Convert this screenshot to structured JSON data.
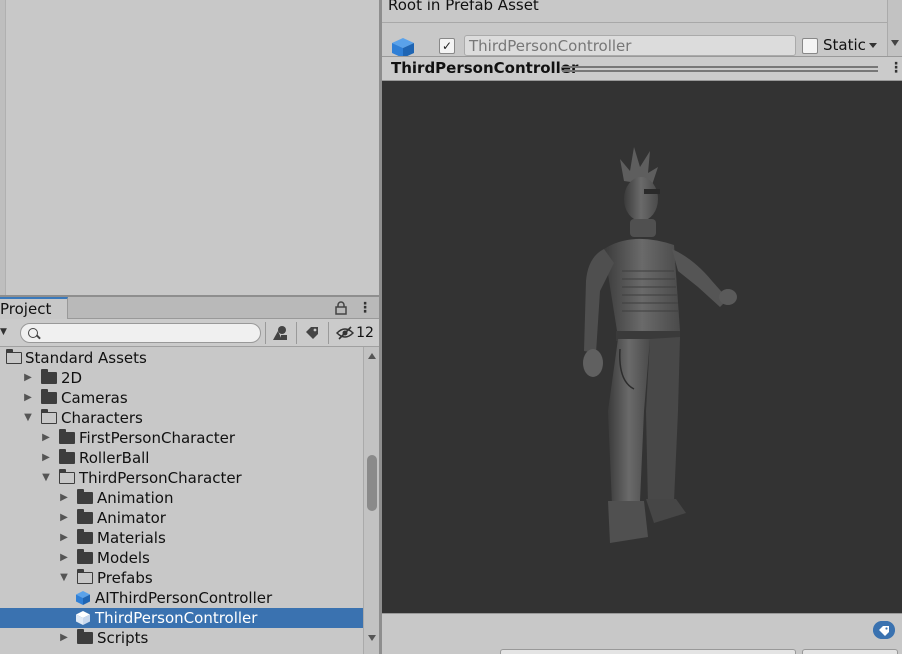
{
  "inspector": {
    "header_text": "Root in Prefab Asset",
    "object_name": "ThirdPersonController",
    "active_checked": true,
    "active_check_glyph": "✓",
    "static_label": "Static",
    "static_checked": false
  },
  "preview": {
    "title": "ThirdPersonController",
    "menu_glyph": "⋮",
    "background_color": "#333333"
  },
  "project": {
    "tab_label": "Project",
    "menu_glyph": "⋮",
    "hidden_count": "12",
    "search_placeholder": "",
    "tree": [
      {
        "label": "Standard Assets",
        "depth": 0,
        "kind": "folder-open",
        "arrow": "none"
      },
      {
        "label": "2D",
        "depth": 1,
        "kind": "folder",
        "arrow": "collapsed"
      },
      {
        "label": "Cameras",
        "depth": 1,
        "kind": "folder",
        "arrow": "collapsed"
      },
      {
        "label": "Characters",
        "depth": 1,
        "kind": "folder-open",
        "arrow": "expanded"
      },
      {
        "label": "FirstPersonCharacter",
        "depth": 2,
        "kind": "folder",
        "arrow": "collapsed"
      },
      {
        "label": "RollerBall",
        "depth": 2,
        "kind": "folder",
        "arrow": "collapsed"
      },
      {
        "label": "ThirdPersonCharacter",
        "depth": 2,
        "kind": "folder-open",
        "arrow": "expanded"
      },
      {
        "label": "Animation",
        "depth": 3,
        "kind": "folder",
        "arrow": "collapsed"
      },
      {
        "label": "Animator",
        "depth": 3,
        "kind": "folder",
        "arrow": "collapsed"
      },
      {
        "label": "Materials",
        "depth": 3,
        "kind": "folder",
        "arrow": "collapsed"
      },
      {
        "label": "Models",
        "depth": 3,
        "kind": "folder",
        "arrow": "collapsed"
      },
      {
        "label": "Prefabs",
        "depth": 3,
        "kind": "folder-open",
        "arrow": "expanded"
      },
      {
        "label": "AIThirdPersonController",
        "depth": 4,
        "kind": "prefab",
        "arrow": "none"
      },
      {
        "label": "ThirdPersonController",
        "depth": 4,
        "kind": "prefab",
        "arrow": "none",
        "selected": true
      },
      {
        "label": "Scripts",
        "depth": 3,
        "kind": "folder",
        "arrow": "collapsed"
      }
    ]
  },
  "colors": {
    "selection": "#3a72b0",
    "prefab_blue": "#2f7fd6",
    "accent_tab": "#3a79bb"
  }
}
